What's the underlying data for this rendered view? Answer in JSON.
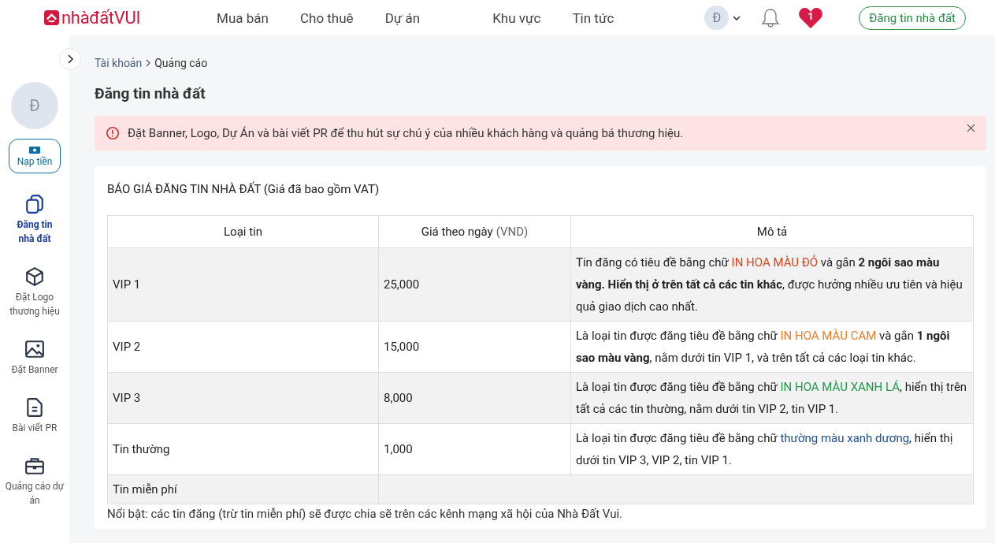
{
  "header": {
    "logo": "nhàđấtVUI",
    "nav": [
      "Mua bán",
      "Cho thuê",
      "Dự án",
      "Khu vực",
      "Tin tức"
    ],
    "avatar_letter": "Đ",
    "notification_count": "1",
    "post_button": "Đăng tin nhà đất"
  },
  "sidebar": {
    "avatar_letter": "Đ",
    "topup_button": "Nạp tiền",
    "items": [
      {
        "label": "Đăng tin nhà đất",
        "kind": "copy",
        "selected": true
      },
      {
        "label": "Đặt Logo thương hiệu",
        "kind": "cube",
        "selected": false
      },
      {
        "label": "Đặt Banner",
        "kind": "image",
        "selected": false
      },
      {
        "label": "Bài viết PR",
        "kind": "document",
        "selected": false
      },
      {
        "label": "Quảng cáo dự án",
        "kind": "briefcase",
        "selected": false
      }
    ]
  },
  "breadcrumb": [
    "Tài khoản",
    "Quảng cáo"
  ],
  "page_title": "Đăng tin nhà đất",
  "alert": "Đặt Banner, Logo, Dự Án và bài viết PR để thu hút sự chú ý của nhiều khách hàng và quảng bá thương hiệu.",
  "price_table": {
    "title": "BÁO GIÁ ĐĂNG TIN NHÀ ĐẤT (Giá đã bao gồm VAT)",
    "columns": [
      {
        "label": "Loại tin"
      },
      {
        "label": "Giá theo ngày",
        "unit": "(VND)"
      },
      {
        "label": "Mô tả"
      }
    ],
    "rows": [
      {
        "type": "VIP 1",
        "price": "25,000",
        "description": [
          {
            "text": "Tin đăng có tiêu đề bằng chữ ",
            "kind": "plain"
          },
          {
            "text": "IN HOA MÀU ĐỎ",
            "kind": "colored",
            "color": "#d9451f"
          },
          {
            "text": " và gắn ",
            "kind": "plain"
          },
          {
            "text": "2 ngôi sao màu vàng. Hiển thị ở trên tất cả các tin khác",
            "kind": "bold"
          },
          {
            "text": ", được hưởng nhiều ưu tiên và hiệu quả giao dịch cao nhất.",
            "kind": "plain"
          }
        ]
      },
      {
        "type": "VIP 2",
        "price": "15,000",
        "description": [
          {
            "text": "Là loại tin được đăng tiêu đề bằng chữ ",
            "kind": "plain"
          },
          {
            "text": "IN HOA MÀU CAM",
            "kind": "colored",
            "color": "#ee7d2b"
          },
          {
            "text": " và gắn ",
            "kind": "plain"
          },
          {
            "text": "1 ngôi sao màu vàng",
            "kind": "bold"
          },
          {
            "text": ", nằm dưới tin VIP 1, và trên tất cả các loại tin khác.",
            "kind": "plain"
          }
        ]
      },
      {
        "type": "VIP 3",
        "price": "8,000",
        "description": [
          {
            "text": "Là loại tin được đăng tiêu đề bằng chữ ",
            "kind": "plain"
          },
          {
            "text": "IN HOA MÀU XANH LÁ",
            "kind": "colored",
            "color": "#219a4a"
          },
          {
            "text": ", hiển thị trên tất cả các tin thường, nằm dưới tin VIP 2, tin VIP 1.",
            "kind": "plain"
          }
        ]
      },
      {
        "type": "Tin thường",
        "price": "1,000",
        "description": [
          {
            "text": "Là loại tin được đăng tiêu đề bằng chữ ",
            "kind": "plain"
          },
          {
            "text": "thường màu xanh dương",
            "kind": "colored",
            "color": "#1d4f91"
          },
          {
            "text": ", hiển thị dưới tin VIP 3, VIP 2, tin VIP 1.",
            "kind": "plain"
          }
        ]
      },
      {
        "type": "Tin miễn phí"
      }
    ],
    "note": "Nổi bật: các tin đăng (trừ tin miễn phí) sẽ được chia sẽ trên các kênh mạng xã hội của Nhà Đất Vui."
  }
}
